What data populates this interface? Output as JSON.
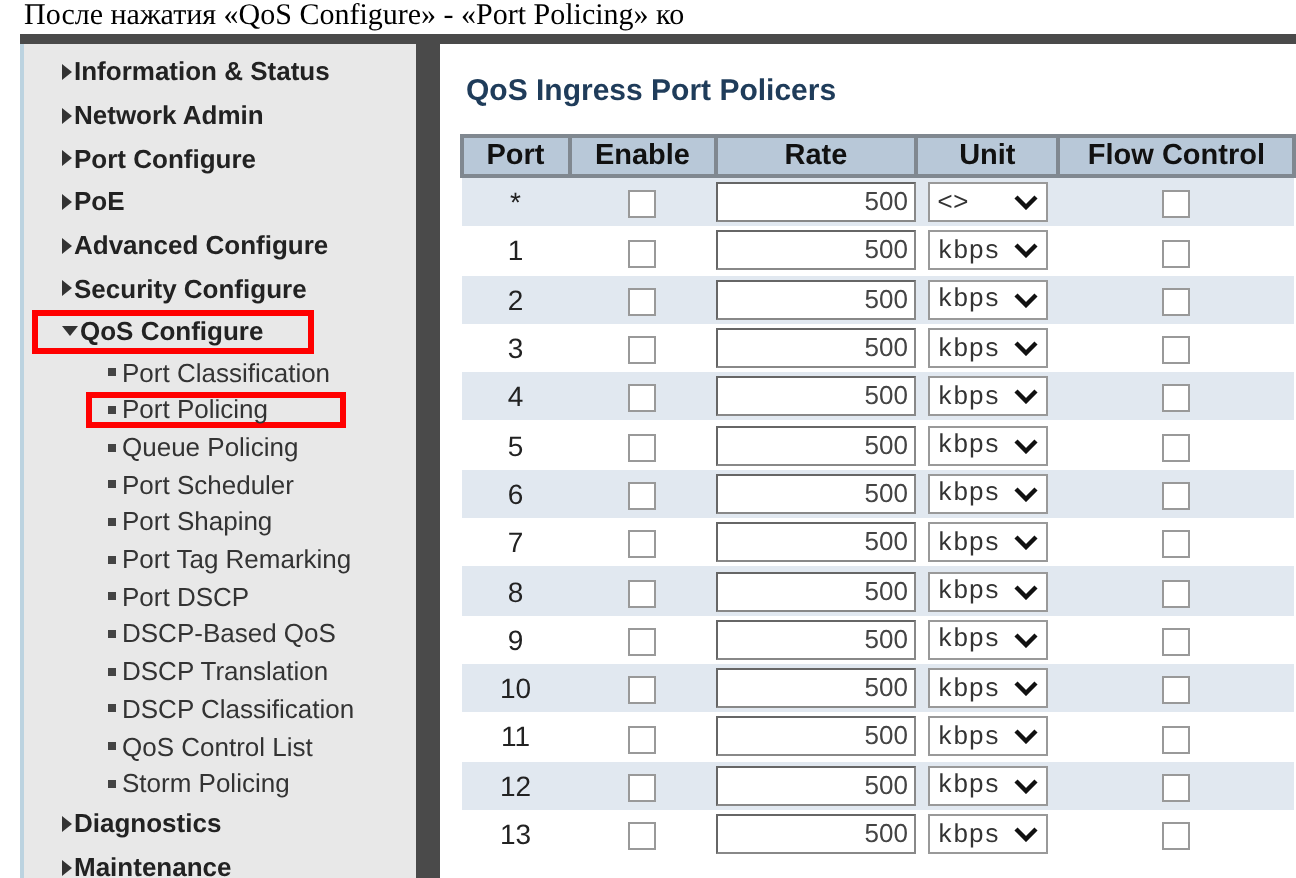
{
  "caption": "После нажатия «QoS Configure» - «Port Policing» ко",
  "sidebar": {
    "items": [
      {
        "label": "Information & Status",
        "expanded": false,
        "highlighted": false
      },
      {
        "label": "Network Admin",
        "expanded": false,
        "highlighted": false
      },
      {
        "label": "Port Configure",
        "expanded": false,
        "highlighted": false
      },
      {
        "label": "PoE",
        "expanded": false,
        "highlighted": false
      },
      {
        "label": "Advanced Configure",
        "expanded": false,
        "highlighted": false
      },
      {
        "label": "Security Configure",
        "expanded": false,
        "highlighted": false
      },
      {
        "label": "QoS Configure",
        "expanded": true,
        "highlighted": true,
        "children": [
          {
            "label": "Port Classification",
            "highlighted": false
          },
          {
            "label": "Port Policing",
            "highlighted": true
          },
          {
            "label": "Queue Policing",
            "highlighted": false
          },
          {
            "label": "Port Scheduler",
            "highlighted": false
          },
          {
            "label": "Port Shaping",
            "highlighted": false
          },
          {
            "label": "Port Tag Remarking",
            "highlighted": false
          },
          {
            "label": "Port DSCP",
            "highlighted": false
          },
          {
            "label": "DSCP-Based QoS",
            "highlighted": false
          },
          {
            "label": "DSCP Translation",
            "highlighted": false
          },
          {
            "label": "DSCP Classification",
            "highlighted": false
          },
          {
            "label": "QoS Control List",
            "highlighted": false
          },
          {
            "label": "Storm Policing",
            "highlighted": false
          }
        ]
      },
      {
        "label": "Diagnostics",
        "expanded": false,
        "highlighted": false
      },
      {
        "label": "Maintenance",
        "expanded": false,
        "highlighted": false
      }
    ]
  },
  "page_title": "QoS Ingress Port Policers",
  "table": {
    "columns": [
      "Port",
      "Enable",
      "Rate",
      "Unit",
      "Flow Control"
    ],
    "rows": [
      {
        "port": "*",
        "enable": false,
        "rate": "500",
        "unit": "<>",
        "flow_control": false
      },
      {
        "port": "1",
        "enable": false,
        "rate": "500",
        "unit": "kbps",
        "flow_control": false
      },
      {
        "port": "2",
        "enable": false,
        "rate": "500",
        "unit": "kbps",
        "flow_control": false
      },
      {
        "port": "3",
        "enable": false,
        "rate": "500",
        "unit": "kbps",
        "flow_control": false
      },
      {
        "port": "4",
        "enable": false,
        "rate": "500",
        "unit": "kbps",
        "flow_control": false
      },
      {
        "port": "5",
        "enable": false,
        "rate": "500",
        "unit": "kbps",
        "flow_control": false
      },
      {
        "port": "6",
        "enable": false,
        "rate": "500",
        "unit": "kbps",
        "flow_control": false
      },
      {
        "port": "7",
        "enable": false,
        "rate": "500",
        "unit": "kbps",
        "flow_control": false
      },
      {
        "port": "8",
        "enable": false,
        "rate": "500",
        "unit": "kbps",
        "flow_control": false
      },
      {
        "port": "9",
        "enable": false,
        "rate": "500",
        "unit": "kbps",
        "flow_control": false
      },
      {
        "port": "10",
        "enable": false,
        "rate": "500",
        "unit": "kbps",
        "flow_control": false
      },
      {
        "port": "11",
        "enable": false,
        "rate": "500",
        "unit": "kbps",
        "flow_control": false
      },
      {
        "port": "12",
        "enable": false,
        "rate": "500",
        "unit": "kbps",
        "flow_control": false
      },
      {
        "port": "13",
        "enable": false,
        "rate": "500",
        "unit": "kbps",
        "flow_control": false
      }
    ]
  }
}
